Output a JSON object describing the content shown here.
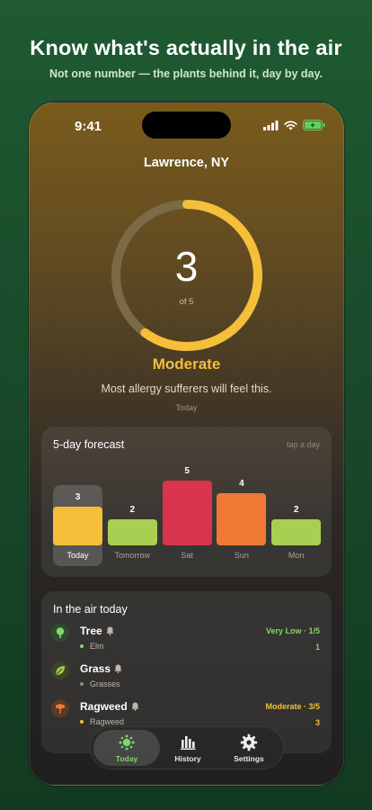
{
  "headline": "Know what's actually in the air",
  "subhead": "Not one number — the plants behind it, day by day.",
  "status": {
    "time": "9:41"
  },
  "location": "Lawrence, NY",
  "today": {
    "value": 3,
    "value_text": "3",
    "of_text": "of 5",
    "level": "Moderate",
    "description": "Most allergy sufferers will feel this.",
    "caption": "Today",
    "fraction": 0.6
  },
  "forecast": {
    "title": "5-day forecast",
    "hint": "tap a day",
    "days": [
      {
        "label": "Today",
        "value": 3,
        "value_text": "3",
        "color": "#f5bf3a",
        "selected": true
      },
      {
        "label": "Tomorrow",
        "value": 2,
        "value_text": "2",
        "color": "#a9cf52",
        "selected": false
      },
      {
        "label": "Sat",
        "value": 5,
        "value_text": "5",
        "color": "#d8344b",
        "selected": false
      },
      {
        "label": "Sun",
        "value": 4,
        "value_text": "4",
        "color": "#f07a35",
        "selected": false
      },
      {
        "label": "Mon",
        "value": 2,
        "value_text": "2",
        "color": "#a9cf52",
        "selected": false
      }
    ]
  },
  "in_air": {
    "title": "In the air today",
    "plants": [
      {
        "name": "Tree",
        "icon": "tree-icon",
        "level": "Very Low · 1/5",
        "level_color": "#7fd66a",
        "sub": "Elm",
        "sub_dot": "#7fd66a",
        "count": "1"
      },
      {
        "name": "Grass",
        "icon": "leaf-icon",
        "level": "",
        "level_color": "#7fd66a",
        "sub": "Grasses",
        "sub_dot": "#8f8a82",
        "count": ""
      },
      {
        "name": "Ragweed",
        "icon": "flower-icon",
        "level": "Moderate · 3/5",
        "level_color": "#f5bf3a",
        "sub": "Ragweed",
        "sub_dot": "#f5bf3a",
        "count": "3"
      }
    ]
  },
  "tabs": [
    {
      "label": "Today",
      "icon": "pollen-icon",
      "active": true
    },
    {
      "label": "History",
      "icon": "bar-chart-icon",
      "active": false
    },
    {
      "label": "Settings",
      "icon": "gear-icon",
      "active": false
    }
  ],
  "colors": {
    "accent_green": "#7fd66a",
    "moderate": "#f5bf3a",
    "ring_track": "#7a6a45"
  }
}
